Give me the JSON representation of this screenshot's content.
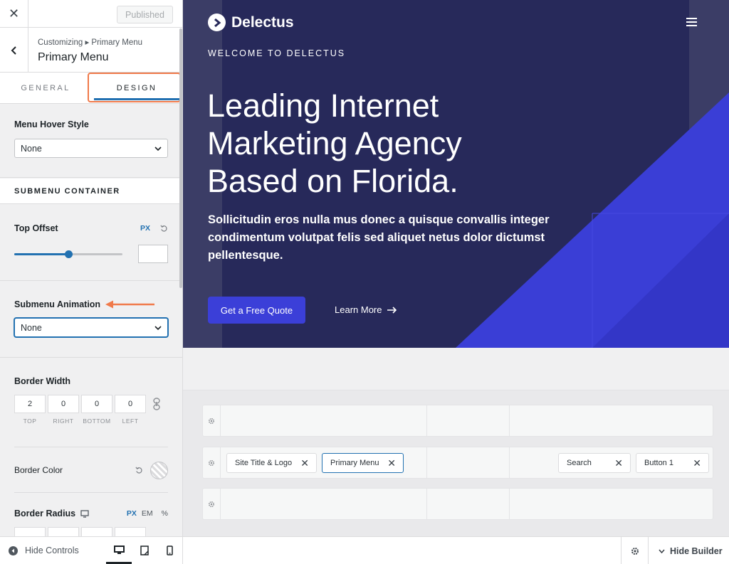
{
  "panel": {
    "close_label": "✕",
    "published_label": "Published",
    "breadcrumb": "Customizing ▸ Primary Menu",
    "section_title": "Primary Menu",
    "tabs": [
      {
        "label": "GENERAL"
      },
      {
        "label": "DESIGN",
        "active": true
      }
    ],
    "menu_hover_style": {
      "label": "Menu Hover Style",
      "value": "None"
    },
    "submenu_container_heading": "SUBMENU CONTAINER",
    "top_offset": {
      "label": "Top Offset",
      "unit": "PX",
      "slider_fraction": 0.5,
      "value": ""
    },
    "submenu_animation": {
      "label": "Submenu Animation",
      "value": "None"
    },
    "border_width": {
      "label": "Border Width",
      "fields": [
        {
          "value": "2",
          "label": "TOP"
        },
        {
          "value": "0",
          "label": "RIGHT"
        },
        {
          "value": "0",
          "label": "BOTTOM"
        },
        {
          "value": "0",
          "label": "LEFT"
        }
      ]
    },
    "border_color": {
      "label": "Border Color"
    },
    "border_radius": {
      "label": "Border Radius",
      "units": [
        "PX",
        "EM",
        "%"
      ]
    },
    "footer": {
      "hide_controls": "Hide Controls"
    }
  },
  "preview": {
    "brand": "Delectus",
    "welcome": "WELCOME TO DELECTUS",
    "headline": "Leading Internet Marketing Agency Based on Florida.",
    "lead": "Sollicitudin eros nulla mus donec a quisque convallis integer condimentum volutpat felis sed aliquet netus dolor dictumst pellentesque.",
    "cta": "Get a Free Quote",
    "learn_more": "Learn More",
    "colors": {
      "hero_bg": "#27295a",
      "accent": "#3b3fd8"
    }
  },
  "builder": {
    "items": {
      "site_title": "Site Title & Logo",
      "primary_menu": "Primary Menu",
      "search": "Search",
      "button1": "Button 1"
    },
    "hide_builder": "Hide Builder"
  }
}
